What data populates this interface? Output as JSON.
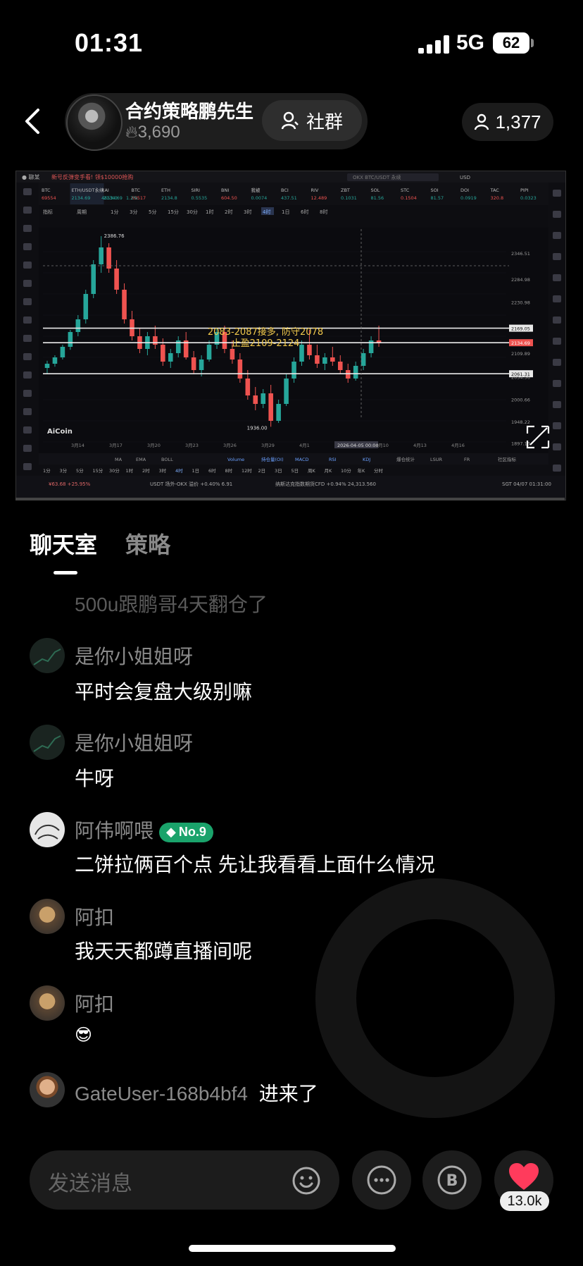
{
  "status_bar": {
    "time": "01:31",
    "network": "5G",
    "battery": "62"
  },
  "host": {
    "name": "合约策略鹏先生",
    "heat": "3,690",
    "community_label": "社群",
    "viewers": "1,377"
  },
  "chart_data": {
    "type": "candlestick",
    "symbol": "ETH/USDT永续",
    "price_label": "2134.69",
    "change_label": "1.2%",
    "top_tabs": [
      "BTC",
      "ETH/USDT永续",
      "XAI",
      "BTC",
      "ETH",
      "SIRI",
      "BNI",
      "我被",
      "BCI",
      "RIV",
      "ZBT",
      "SOL",
      "STC",
      "SOI",
      "DOI",
      "TAC",
      "PIPI"
    ],
    "top_values": [
      "69554",
      "2134.69",
      "4653.0",
      "69517",
      "2134.8",
      "0.5535",
      "604.50",
      "0.0074",
      "437.51",
      "12.489",
      "0.1031",
      "81.56",
      "0.1504",
      "81.57",
      "0.0919",
      "320.8",
      "0.0323"
    ],
    "ticker_text": "新号反弹变手看! 领$10000抢购",
    "search_placeholder": "OKX BTC/USDT 永续",
    "currency": "USD",
    "timeframes_toolbar": [
      "指标",
      "周期",
      "1分",
      "3分",
      "5分",
      "15分",
      "30分",
      "1时",
      "2时",
      "3时",
      "4时",
      "1日",
      "6时",
      "8时"
    ],
    "right_axis": [
      "2346.51",
      "2284.98",
      "2230.98",
      "2169.05",
      "2134.69",
      "2109.89",
      "2061.31",
      "2054.56",
      "2000.66",
      "1948.22",
      "1897.13"
    ],
    "x_labels": [
      "3月14",
      "3月17",
      "3月20",
      "3月23",
      "3月26",
      "3月29",
      "4月1",
      "2026-04-05 00:00",
      "4月10",
      "4月13",
      "4月16"
    ],
    "high_label": "2386.76",
    "low_label": "1936.00",
    "horizontal_levels": [
      2169.05,
      2134.69,
      2061.31
    ],
    "annotation_line1": "2083-2087接多, 防守2078",
    "annotation_line2": "止盈2109-2124",
    "brand": "AiCoin",
    "indicator_tabs": [
      "Volume",
      "持仓量(OI)",
      "MACD",
      "RSI",
      "KDJ",
      "爆仓统计",
      "LSUR",
      "FR",
      "社区指标"
    ],
    "bottom_timeframes": [
      "1分",
      "3分",
      "5分",
      "15分",
      "30分",
      "1时",
      "2时",
      "3时",
      "4时",
      "1日",
      "6时",
      "8时",
      "12时",
      "2日",
      "3日",
      "5日",
      "周K",
      "月K",
      "10分",
      "年K",
      "分时"
    ],
    "footer_left": "¥63.68 +25.95%",
    "footer_mid": "USDT 场外-OKX 溢价 +0.40% 6.91",
    "footer_mid2": "纳斯达克指数期货CFD +0.94% 24,313.560",
    "footer_right": "SGT 04/07 01:31:00",
    "candles": [
      [
        2075,
        2092,
        2060,
        2085
      ],
      [
        2085,
        2105,
        2078,
        2100
      ],
      [
        2100,
        2130,
        2095,
        2125
      ],
      [
        2125,
        2165,
        2118,
        2160
      ],
      [
        2160,
        2200,
        2150,
        2190
      ],
      [
        2190,
        2260,
        2180,
        2250
      ],
      [
        2250,
        2330,
        2240,
        2320
      ],
      [
        2320,
        2386.76,
        2300,
        2360
      ],
      [
        2360,
        2370,
        2300,
        2310
      ],
      [
        2310,
        2330,
        2250,
        2260
      ],
      [
        2260,
        2275,
        2180,
        2190
      ],
      [
        2190,
        2210,
        2140,
        2150
      ],
      [
        2150,
        2170,
        2110,
        2120
      ],
      [
        2120,
        2160,
        2105,
        2150
      ],
      [
        2150,
        2175,
        2120,
        2130
      ],
      [
        2130,
        2145,
        2080,
        2090
      ],
      [
        2090,
        2120,
        2075,
        2110
      ],
      [
        2110,
        2150,
        2100,
        2140
      ],
      [
        2140,
        2160,
        2095,
        2100
      ],
      [
        2100,
        2115,
        2060,
        2070
      ],
      [
        2070,
        2105,
        2055,
        2095
      ],
      [
        2095,
        2140,
        2090,
        2130
      ],
      [
        2130,
        2170,
        2120,
        2160
      ],
      [
        2160,
        2175,
        2110,
        2120
      ],
      [
        2120,
        2140,
        2085,
        2095
      ],
      [
        2095,
        2110,
        2040,
        2050
      ],
      [
        2050,
        2070,
        2000,
        2010
      ],
      [
        2010,
        2030,
        1975,
        1990
      ],
      [
        1990,
        2025,
        1980,
        2015
      ],
      [
        2015,
        2035,
        1936,
        1950
      ],
      [
        1950,
        2000,
        1945,
        1990
      ],
      [
        1990,
        2060,
        1985,
        2050
      ],
      [
        2050,
        2100,
        2040,
        2090
      ],
      [
        2090,
        2140,
        2080,
        2130
      ],
      [
        2130,
        2165,
        2095,
        2105
      ],
      [
        2105,
        2130,
        2075,
        2085
      ],
      [
        2085,
        2110,
        2070,
        2100
      ],
      [
        2100,
        2125,
        2080,
        2090
      ],
      [
        2090,
        2105,
        2060,
        2070
      ],
      [
        2070,
        2085,
        2040,
        2050
      ],
      [
        2050,
        2090,
        2045,
        2080
      ],
      [
        2080,
        2120,
        2070,
        2110
      ],
      [
        2110,
        2150,
        2100,
        2140
      ],
      [
        2140,
        2175,
        2125,
        2134.69
      ]
    ]
  },
  "tabs": {
    "chat": "聊天室",
    "strategy": "策略"
  },
  "chat": {
    "prev_message": "500u跟鹏哥4天翻仓了",
    "messages": [
      {
        "name": "是你小姐姐呀",
        "text": "平时会复盘大级别嘛"
      },
      {
        "name": "是你小姐姐呀",
        "text": "牛呀"
      },
      {
        "name": "阿伟啊喂",
        "badge": "No.9",
        "text": "二饼拉俩百个点   先让我看看上面什么情况"
      },
      {
        "name": "阿扣",
        "text": "我天天都蹲直播间呢"
      },
      {
        "name": "阿扣",
        "text": "😎"
      },
      {
        "name": "GateUser-168b4bf4",
        "text": "进来了"
      }
    ]
  },
  "input": {
    "placeholder": "发送消息"
  },
  "likes": "13.0k",
  "colors": {
    "up": "#26a69a",
    "down": "#ef5350",
    "accent_green": "#1aa36b",
    "like_red": "#ff3b5c"
  }
}
